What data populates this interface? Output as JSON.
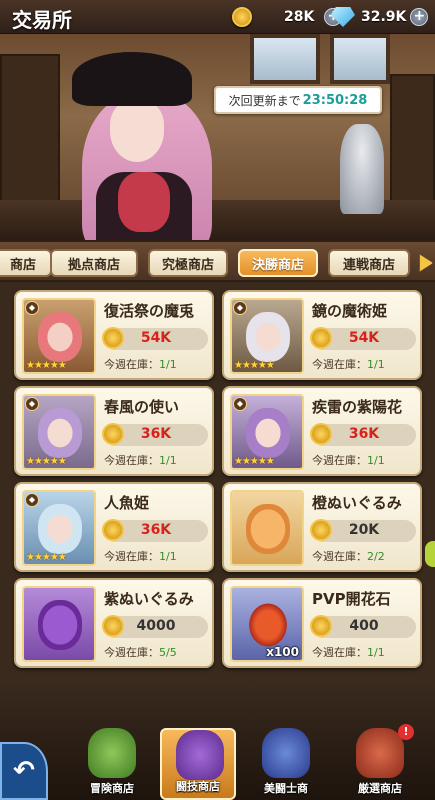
{
  "header": {
    "title": "交易所",
    "medals": "28K",
    "gems": "32.9K"
  },
  "scene": {
    "timer_label": "次回更新まで",
    "timer_value": "23:50:28"
  },
  "tabs": [
    {
      "label": "商店",
      "active": false
    },
    {
      "label": "拠点商店",
      "active": false
    },
    {
      "label": "究極商店",
      "active": false
    },
    {
      "label": "決勝商店",
      "active": true
    },
    {
      "label": "連戦商店",
      "active": false
    }
  ],
  "items": [
    {
      "name": "復活祭の魔兎",
      "price": "54K",
      "stock_label": "今週在庫：",
      "stock": "1/1",
      "price_red": true
    },
    {
      "name": "鏡の魔術姫",
      "price": "54K",
      "stock_label": "今週在庫：",
      "stock": "1/1",
      "price_red": true
    },
    {
      "name": "春風の使い",
      "price": "36K",
      "stock_label": "今週在庫：",
      "stock": "1/1",
      "price_red": true
    },
    {
      "name": "疾雷の紫陽花",
      "price": "36K",
      "stock_label": "今週在庫：",
      "stock": "1/1",
      "price_red": true
    },
    {
      "name": "人魚姫",
      "price": "36K",
      "stock_label": "今週在庫：",
      "stock": "1/1",
      "price_red": true
    },
    {
      "name": "橙ぬいぐるみ",
      "price": "20K",
      "stock_label": "今週在庫：",
      "stock": "2/2",
      "price_red": false
    },
    {
      "name": "紫ぬいぐるみ",
      "price": "4000",
      "stock_label": "今週在庫：",
      "stock": "5/5",
      "price_red": false
    },
    {
      "name": "PVP開花石",
      "price": "400",
      "stock_label": "今週在庫：",
      "stock": "1/1",
      "price_red": false,
      "quantity": "x100"
    }
  ],
  "bottom_nav": [
    {
      "label": "冒険商店",
      "active": false
    },
    {
      "label": "闘技商店",
      "active": true
    },
    {
      "label": "美闘士商",
      "active": false
    },
    {
      "label": "厳選商店",
      "active": false,
      "alert": "!"
    }
  ],
  "colors": {
    "accent": "#e3912a",
    "price_red": "#d9221b",
    "stock_green": "#2f8f2a",
    "timer": "#1b9d9b"
  }
}
